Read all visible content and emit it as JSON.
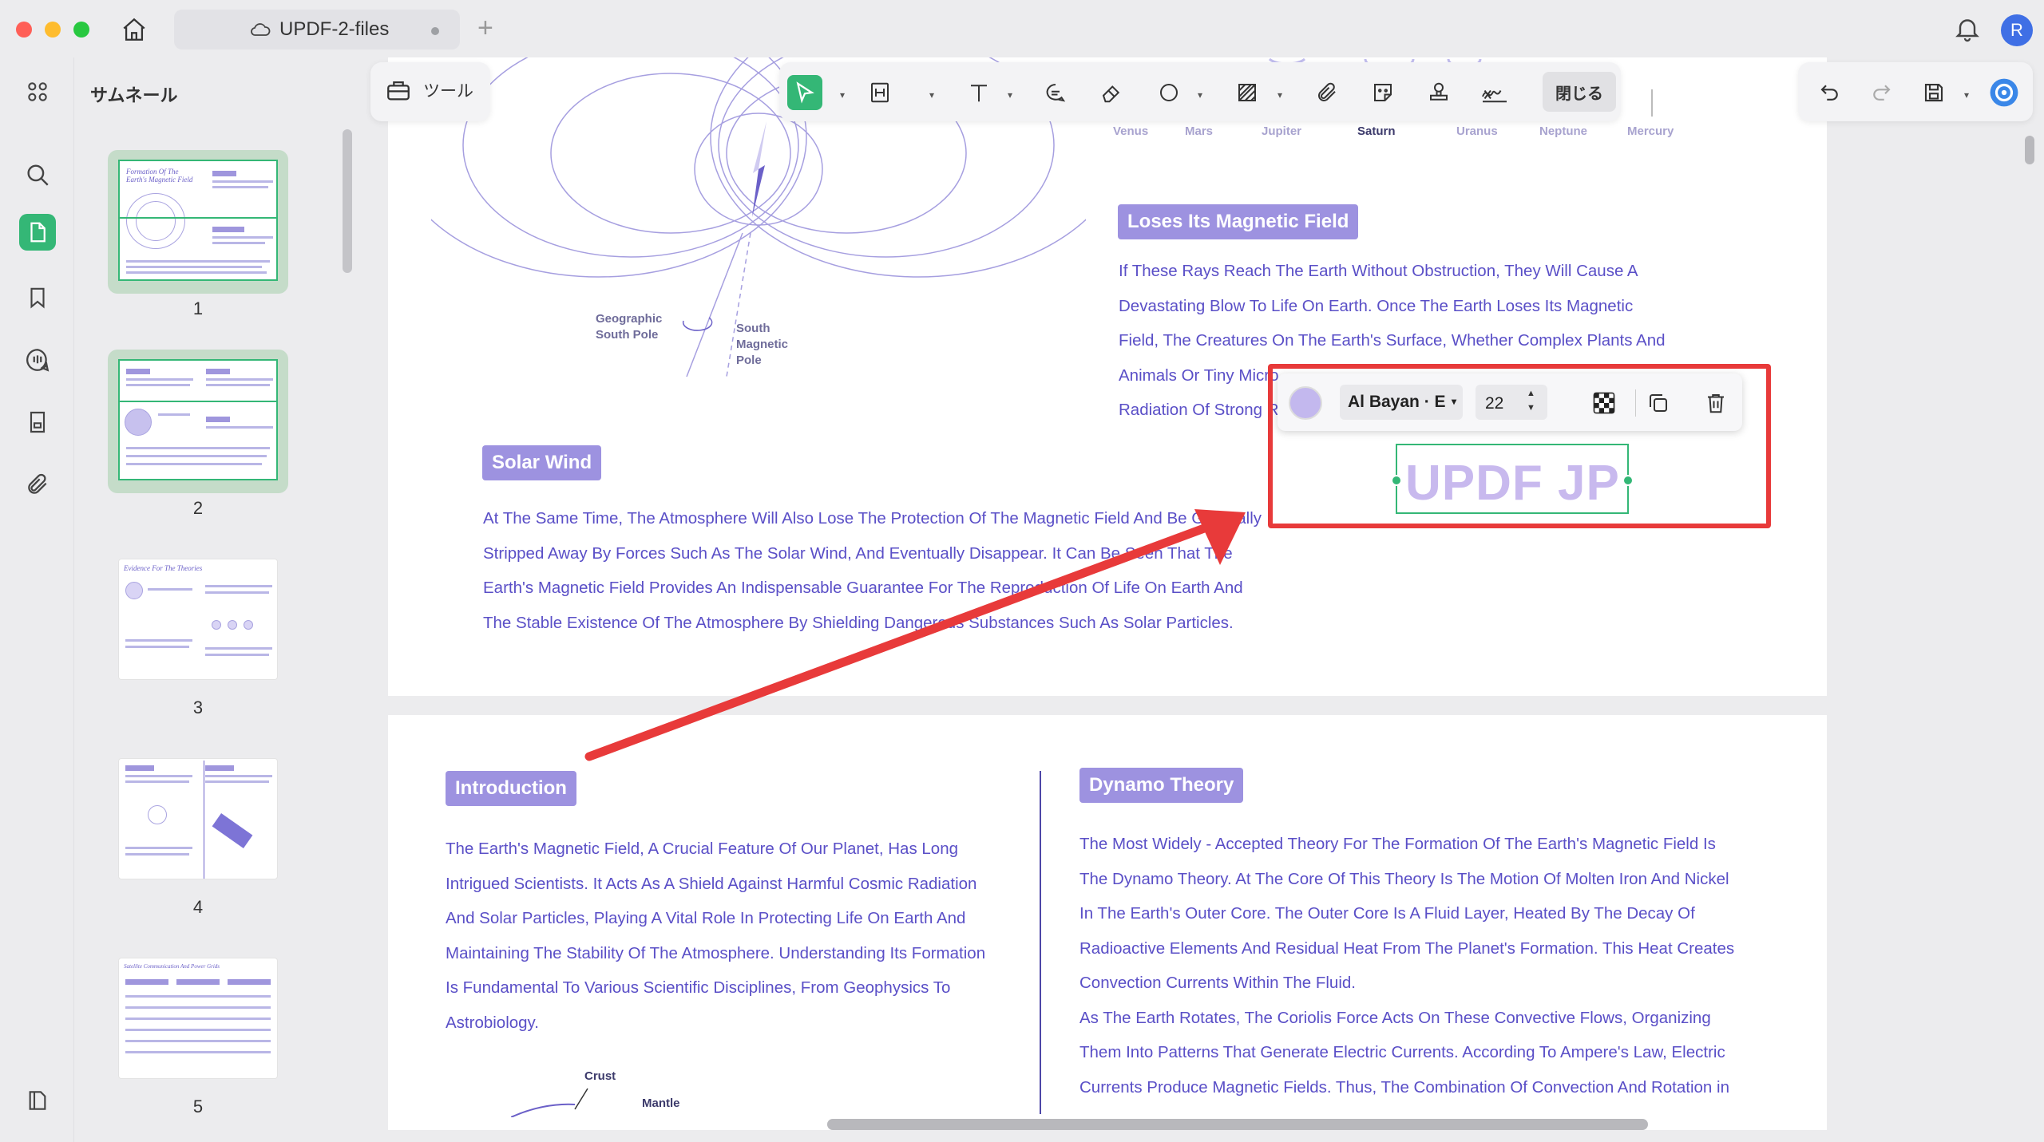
{
  "window": {
    "tab_title": "UPDF-2-files",
    "user_initial": "R"
  },
  "thumbnails": {
    "title": "サムネール",
    "pages": [
      {
        "num": "1",
        "head": "Formation Of The Earth's Magnetic Field"
      },
      {
        "num": "2"
      },
      {
        "num": "3",
        "head": "Evidence For The Theories"
      },
      {
        "num": "4"
      },
      {
        "num": "5",
        "head": "Satellite Communication And Power Grids"
      }
    ]
  },
  "toolbar": {
    "tools_label": "ツール",
    "close_label": "閉じる"
  },
  "planets": [
    "Venus",
    "Mars",
    "Jupiter",
    "Saturn",
    "Uranus",
    "Neptune",
    "Mercury"
  ],
  "diagram": {
    "label_geo": [
      "Geographic",
      "South Pole"
    ],
    "label_mag": [
      "South",
      "Magnetic",
      "Pole"
    ]
  },
  "page1": {
    "loses_title": "Loses Its Magnetic Field",
    "loses_lines": [
      "If These Rays Reach The Earth Without Obstruction, They Will Cause A",
      "Devastating Blow To Life On Earth. Once The Earth Loses Its Magnetic",
      "Field, The Creatures On The Earth's Surface, Whether Complex Plants And",
      "Animals Or Tiny Micro",
      "Radiation Of Strong R"
    ],
    "solar_title": "Solar Wind",
    "solar_lines": [
      "At The Same Time, The Atmosphere Will Also Lose The Protection Of The Magnetic Field And Be Gradually",
      "Stripped Away By Forces Such As The Solar Wind, And Eventually Disappear. It Can Be Seen That The",
      "Earth's Magnetic Field Provides An Indispensable Guarantee For The Reproduction Of Life On Earth And",
      "The Stable Existence Of The Atmosphere By Shielding Dangerous Substances Such As Solar Particles."
    ]
  },
  "page2": {
    "intro_title": "Introduction",
    "intro_lines": [
      "The Earth's Magnetic Field, A Crucial Feature Of Our Planet, Has Long",
      "Intrigued Scientists. It Acts As A Shield Against Harmful Cosmic Radiation",
      "And Solar Particles, Playing A Vital Role In Protecting Life On Earth And",
      "Maintaining The Stability Of The Atmosphere. Understanding Its Formation",
      "Is Fundamental To Various Scientific Disciplines, From Geophysics To",
      "Astrobiology."
    ],
    "dynamo_title": "Dynamo Theory",
    "dynamo_lines": [
      "The Most Widely - Accepted Theory For The Formation Of The Earth's Magnetic Field Is",
      "The Dynamo Theory. At The Core Of This Theory Is The Motion Of Molten Iron And Nickel",
      "In The Earth's Outer Core. The Outer Core Is A Fluid Layer, Heated By The Decay Of",
      "Radioactive Elements And Residual Heat From The Planet's Formation. This Heat Creates",
      "Convection Currents Within The Fluid.",
      "As The Earth Rotates, The Coriolis Force Acts On These Convective Flows, Organizing",
      "Them Into Patterns That Generate Electric Currents. According To Ampere's Law, Electric",
      "Currents Produce Magnetic Fields. Thus, The Combination Of Convection And Rotation in"
    ],
    "crust_label": "Crust",
    "mantle_label": "Mantle"
  },
  "text_edit": {
    "font": "Al Bayan · E",
    "size": "22",
    "text": "UPDF JP",
    "color": "#c8b9ee"
  },
  "colors": {
    "accent": "#34b776",
    "annotation_red": "#e83a3a",
    "tag_purple": "#9d92e0",
    "text_purple": "#5a4fc7"
  }
}
